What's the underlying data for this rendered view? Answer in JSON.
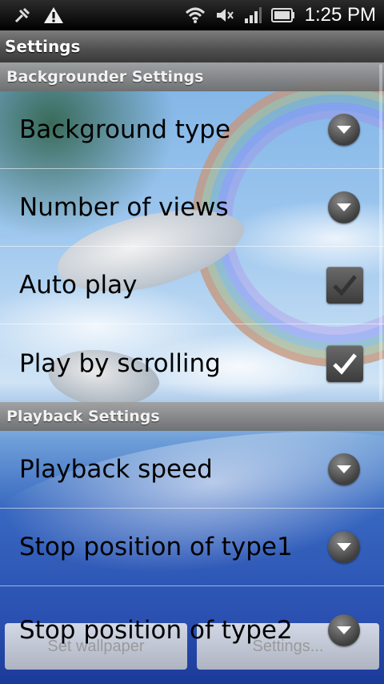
{
  "status_bar": {
    "time": "1:25 PM",
    "icons": [
      "usb-debug-icon",
      "warning-icon",
      "wifi-icon",
      "mute-icon",
      "signal-icon",
      "battery-icon"
    ]
  },
  "title": "Settings",
  "sections": [
    {
      "header": "Backgrounder Settings",
      "items": [
        {
          "label": "Background type",
          "control": "dropdown"
        },
        {
          "label": "Number of views",
          "control": "dropdown"
        },
        {
          "label": "Auto play",
          "control": "checkbox",
          "checked": true,
          "enabled": false
        },
        {
          "label": "Play by scrolling",
          "control": "checkbox",
          "checked": true,
          "enabled": true
        }
      ]
    },
    {
      "header": "Playback Settings",
      "items": [
        {
          "label": "Playback speed",
          "control": "dropdown"
        },
        {
          "label": "Stop position of type1",
          "control": "dropdown"
        },
        {
          "label": "Stop position of type2",
          "control": "dropdown"
        }
      ]
    }
  ],
  "buttons": {
    "set_wallpaper": "Set wallpaper",
    "settings": "Settings..."
  }
}
